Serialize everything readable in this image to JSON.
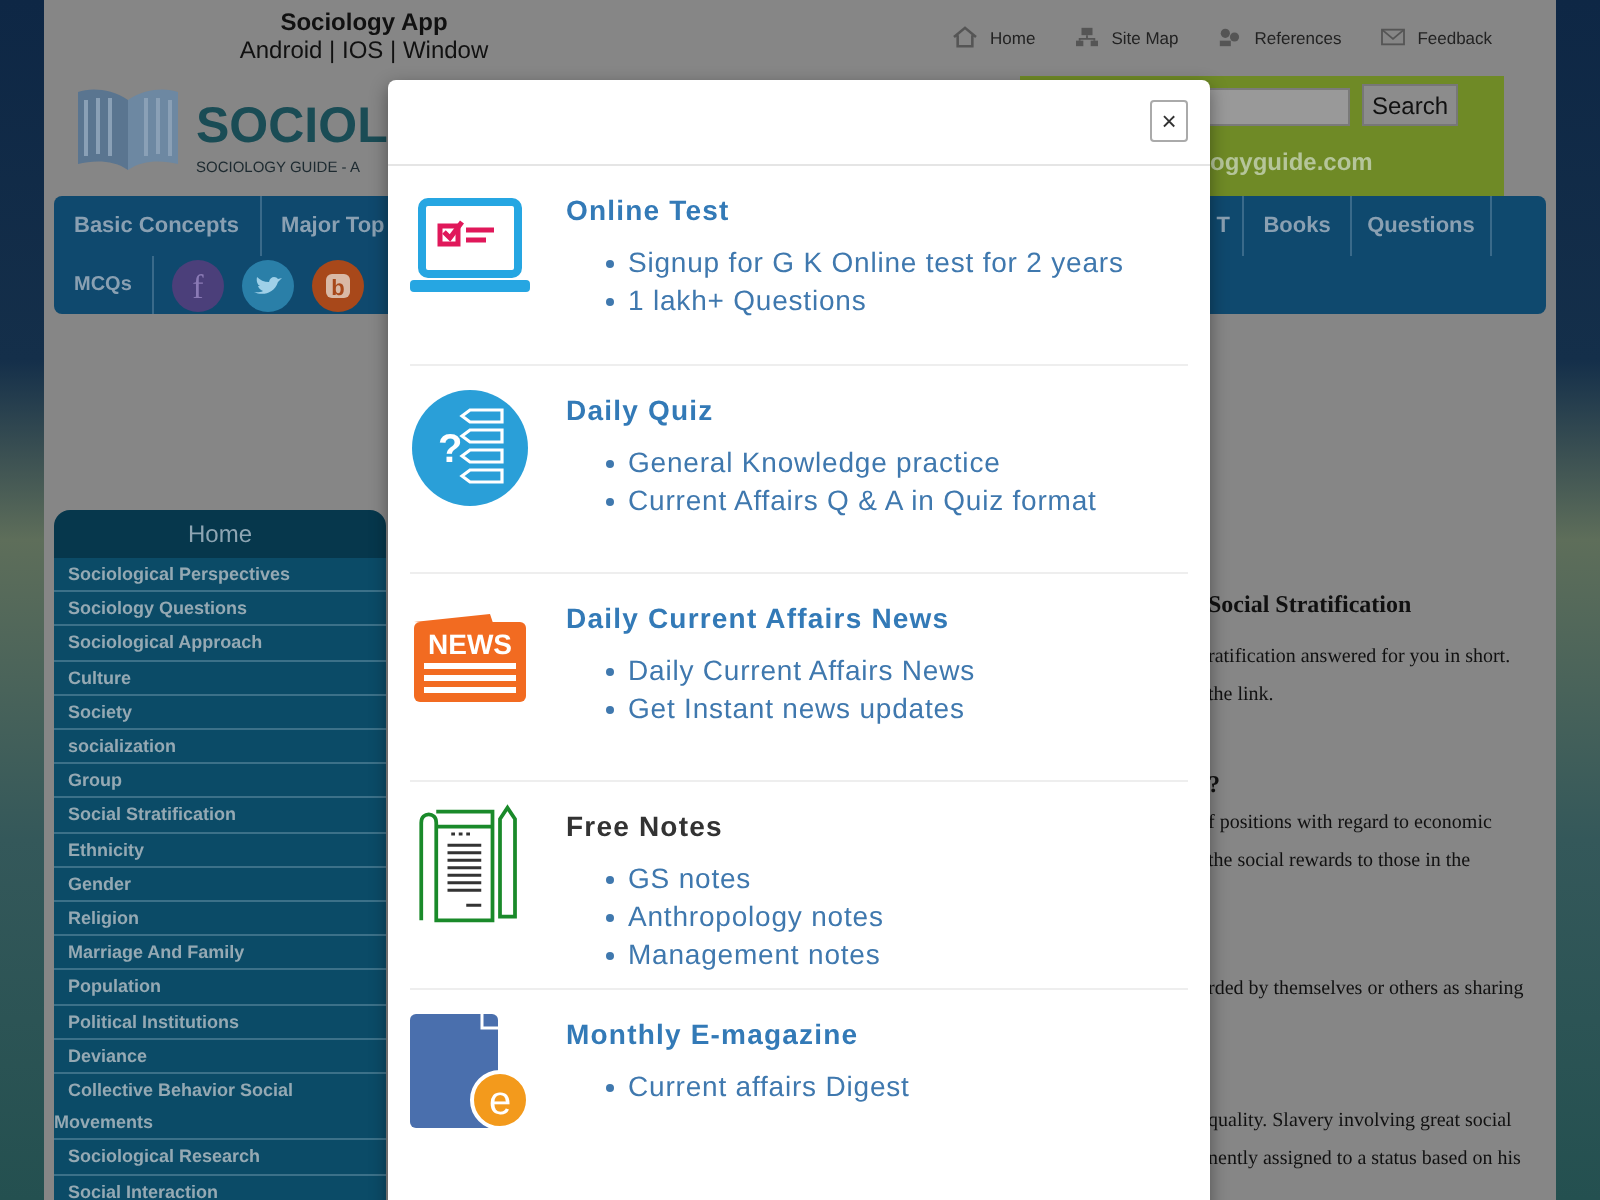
{
  "header": {
    "app_title": "Sociology App",
    "platforms": "Android | IOS | Window",
    "links": [
      {
        "kind": "home",
        "label": "Home"
      },
      {
        "kind": "sitemap",
        "label": "Site Map"
      },
      {
        "kind": "references",
        "label": "References"
      },
      {
        "kind": "feedback",
        "label": "Feedback"
      }
    ]
  },
  "logo": {
    "name": "SOCIOL",
    "tagline": "SOCIOLOGY GUIDE - A"
  },
  "search": {
    "button": "Search",
    "site": "ogyguide.com"
  },
  "nav": {
    "left": [
      "Basic Concepts",
      "Major Top"
    ],
    "right": [
      "T",
      "Books",
      "Questions"
    ],
    "second_row": "MCQs",
    "social": [
      {
        "kind": "f",
        "glyph": "f"
      },
      {
        "kind": "bird"
      },
      {
        "kind": "b",
        "glyph": "b"
      }
    ]
  },
  "sidebar": {
    "title": "Home",
    "items": [
      "Sociological Perspectives",
      "Sociology Questions",
      "Sociological Approach",
      "Culture",
      "Society",
      "socialization",
      "Group",
      "Social Stratification",
      "Ethnicity",
      "Gender",
      "Religion",
      "Marriage And Family",
      "Population",
      "Political Institutions",
      "Deviance",
      "Collective Behavior Social Movements",
      "Sociological Research",
      "Social Interaction"
    ]
  },
  "content": [
    {
      "kind": "heading",
      "text": "Social Stratification"
    },
    {
      "kind": "line",
      "text": "ratification answered for you in short."
    },
    {
      "kind": "line",
      "text": "the link."
    },
    {
      "kind": "heading",
      "text": "?"
    },
    {
      "kind": "line",
      "text": "f positions with regard to economic"
    },
    {
      "kind": "line",
      "text": "the social rewards to those in the"
    },
    {
      "kind": "line",
      "text": "rded by themselves or others as sharing"
    },
    {
      "kind": "line",
      "text": "quality. Slavery involving great social"
    },
    {
      "kind": "line",
      "text": "nently assigned to a status based on his"
    }
  ],
  "modal": {
    "close": "×",
    "sections": [
      {
        "kind": "test",
        "title": "Online Test",
        "linked": true,
        "items": [
          "Signup for G K Online test for 2 years",
          "1 lakh+ Questions"
        ]
      },
      {
        "kind": "quiz",
        "title": "Daily Quiz",
        "linked": true,
        "icon_text": "?",
        "items": [
          "General Knowledge practice",
          "Current Affairs Q & A in Quiz format"
        ]
      },
      {
        "kind": "news",
        "title": "Daily Current Affairs News",
        "linked": true,
        "icon_text": "NEWS",
        "items": [
          "Daily Current Affairs News",
          "Get Instant news updates"
        ]
      },
      {
        "kind": "notes",
        "title": "Free Notes",
        "linked": false,
        "items": [
          "GS notes",
          "Anthropology notes",
          "Management notes"
        ]
      },
      {
        "kind": "magazine",
        "title": "Monthly E-magazine",
        "linked": true,
        "icon_text": "e",
        "items": [
          "Current affairs Digest"
        ]
      }
    ]
  }
}
